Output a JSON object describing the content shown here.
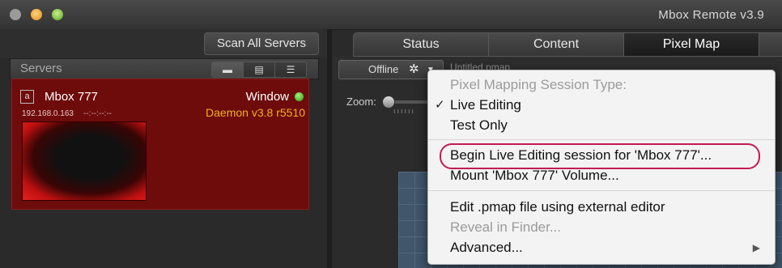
{
  "window": {
    "title": "Mbox Remote v3.9"
  },
  "toolbar": {
    "scan_label": "Scan All Servers"
  },
  "servers": {
    "title": "Servers",
    "view_buttons": [
      "▬",
      "▤",
      "☰"
    ],
    "server": {
      "badge": "a",
      "name": "Mbox 777",
      "ip": "192.168.0.163",
      "time": "--:--:--:--",
      "window_label": "Window",
      "daemon": "Daemon v3.8 r5510",
      "status_color": "#2d9a10"
    }
  },
  "tabs": [
    "Status",
    "Content",
    "Pixel Map"
  ],
  "pixelmap": {
    "offline_label": "Offline",
    "filename": "Untitled.pmap",
    "zoom_label": "Zoom:",
    "zoom_ticks": "ıııııı"
  },
  "menu": {
    "header": "Pixel Mapping Session Type:",
    "live_editing": "Live Editing",
    "test_only": "Test Only",
    "begin_session": "Begin Live Editing session for 'Mbox 777'...",
    "mount_volume": "Mount 'Mbox 777' Volume...",
    "edit_external": "Edit .pmap file using external editor",
    "reveal_finder": "Reveal in Finder...",
    "advanced": "Advanced..."
  },
  "colors": {
    "highlight": "#c21a54",
    "server_bg": "#6e0b0b",
    "daemon_text": "#f0b21e"
  }
}
